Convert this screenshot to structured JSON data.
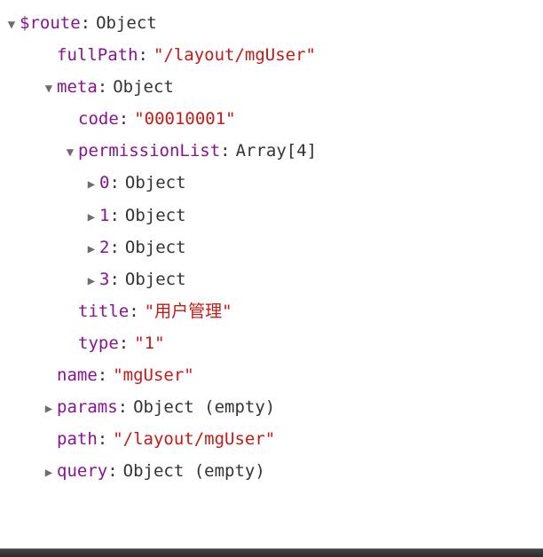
{
  "root": {
    "key": "$route",
    "type": "Object"
  },
  "fullPath": {
    "key": "fullPath",
    "value": "\"/layout/mgUser\""
  },
  "meta": {
    "key": "meta",
    "type": "Object"
  },
  "code": {
    "key": "code",
    "value": "\"00010001\""
  },
  "permissionList": {
    "key": "permissionList",
    "type": "Array[4]"
  },
  "items": [
    {
      "key": "0",
      "type": "Object"
    },
    {
      "key": "1",
      "type": "Object"
    },
    {
      "key": "2",
      "type": "Object"
    },
    {
      "key": "3",
      "type": "Object"
    }
  ],
  "title": {
    "key": "title",
    "value": "\"用户管理\""
  },
  "typeProp": {
    "key": "type",
    "value": "\"1\""
  },
  "name": {
    "key": "name",
    "value": "\"mgUser\""
  },
  "params": {
    "key": "params",
    "type": "Object (empty)"
  },
  "path": {
    "key": "path",
    "value": "\"/layout/mgUser\""
  },
  "query": {
    "key": "query",
    "type": "Object (empty)"
  }
}
